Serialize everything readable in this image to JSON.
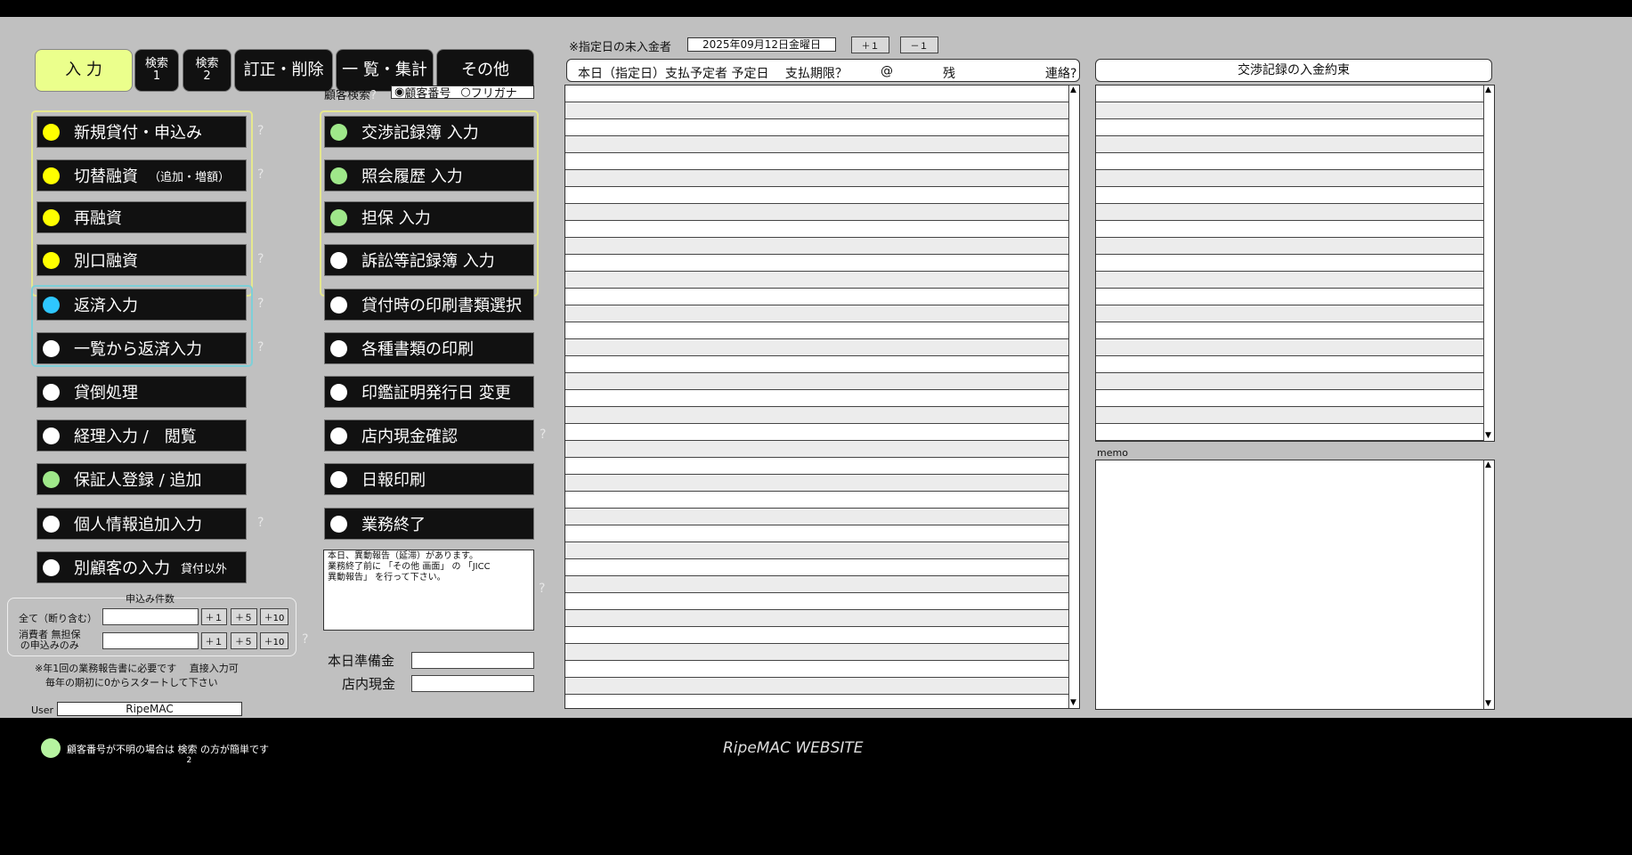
{
  "tabs": [
    {
      "label": "入 力"
    },
    {
      "label": "検索",
      "sub": "1"
    },
    {
      "label": "検索",
      "sub": "2"
    },
    {
      "label": "訂正・削除"
    },
    {
      "label": "一 覧・集計"
    },
    {
      "label": "その他"
    }
  ],
  "customer_search": {
    "label": "顧客検索",
    "help": "?",
    "options": [
      "顧客番号",
      "フリガナ"
    ],
    "selected": "顧客番号"
  },
  "left_buttons": [
    {
      "label": "新規貸付・申込み",
      "dot": "#ffff00",
      "help": "?"
    },
    {
      "label": "切替融資",
      "small": "（追加・増額）",
      "dot": "#ffff00",
      "help": "?"
    },
    {
      "label": "再融資",
      "dot": "#ffff00",
      "help": ""
    },
    {
      "label": "別口融資",
      "dot": "#ffff00",
      "help": "?"
    },
    {
      "label": "返済入力",
      "dot": "#2ec7ff",
      "help": "?"
    },
    {
      "label": "一覧から返済入力",
      "dot": "#ffffff",
      "help": "?"
    },
    {
      "label": "貸倒処理",
      "dot": "#ffffff",
      "help": ""
    },
    {
      "label": "経理入力 /　閲覧",
      "dot": "#ffffff",
      "help": ""
    },
    {
      "label": "保証人登録 / 追加",
      "dot": "#9fe88a",
      "help": ""
    },
    {
      "label": "個人情報追加入力",
      "dot": "#ffffff",
      "help": "?"
    },
    {
      "label": "別顧客の入力",
      "small": "貸付以外",
      "dot": "#ffffff",
      "help": ""
    }
  ],
  "mid_buttons": [
    {
      "label": "交渉記録簿 入力",
      "dot": "#9fe88a",
      "help": ""
    },
    {
      "label": "照会履歴 入力",
      "dot": "#9fe88a",
      "help": ""
    },
    {
      "label": "担保 入力",
      "dot": "#9fe88a",
      "help": ""
    },
    {
      "label": "訴訟等記録簿 入力",
      "dot": "#ffffff",
      "help": ""
    },
    {
      "label": "貸付時の印刷書類選択",
      "dot": "#ffffff",
      "help": ""
    },
    {
      "label": "各種書類の印刷",
      "dot": "#ffffff",
      "help": ""
    },
    {
      "label": "印鑑証明発行日 変更",
      "dot": "#ffffff",
      "help": ""
    },
    {
      "label": "店内現金確認",
      "dot": "#ffffff",
      "help": "?"
    },
    {
      "label": "日報印刷",
      "dot": "#ffffff",
      "help": ""
    },
    {
      "label": "業務終了",
      "dot": "#ffffff",
      "help": ""
    }
  ],
  "notice": {
    "lines": [
      "本日、異動報告（延滞）があります。",
      "業務終了前に 「その他 画面」 の 「JICC",
      "異動報告」 を行って下さい。"
    ],
    "help": "?"
  },
  "applications": {
    "title": "申込み件数",
    "row1_label": "全て（断り含む）",
    "row2_label_1": "消費者 無担保",
    "row2_label_2": "の申込みのみ",
    "steps": [
      "＋１",
      "＋５",
      "＋10"
    ],
    "help": "?",
    "note_1": "※年1回の業務報告書に必要です　 直接入力可",
    "note_2": "毎年の期初に0からスタートして下さい"
  },
  "cash": {
    "reserve_label": "本日準備金",
    "store_label": "店内現金"
  },
  "user": {
    "label": "User",
    "value": "RipeMAC"
  },
  "unpaid": {
    "label": "※指定日の未入金者",
    "date": "2025年09月12日金曜日",
    "plus": "＋１",
    "minus": "－１"
  },
  "list_header": {
    "col1": "本日（指定日）支払予定者 予定日　 支払期限？",
    "col2": "@",
    "col3": "残",
    "col4": "連絡?"
  },
  "right_header": "交渉記録の入金約束",
  "memo_label": "memo",
  "footer": {
    "hint_pre": "顧客番号が不明の場合は",
    "hint_link": "検索",
    "hint_sub": "2",
    "hint_post": "の方が簡単です",
    "website": "RipeMAC WEBSITE"
  }
}
